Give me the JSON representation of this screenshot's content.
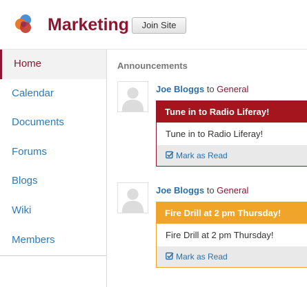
{
  "site": {
    "title": "Marketing",
    "join_label": "Join Site"
  },
  "colors": {
    "brand": "#8d1530",
    "link": "#2b7bb9",
    "announcement_red": "#a5151d",
    "announcement_orange": "#f0a42a"
  },
  "sidebar": {
    "items": [
      {
        "label": "Home",
        "active": true
      },
      {
        "label": "Calendar",
        "active": false
      },
      {
        "label": "Documents",
        "active": false
      },
      {
        "label": "Forums",
        "active": false
      },
      {
        "label": "Blogs",
        "active": false
      },
      {
        "label": "Wiki",
        "active": false
      },
      {
        "label": "Members",
        "active": false
      }
    ]
  },
  "announcements": {
    "title": "Announcements",
    "entries": [
      {
        "author": "Joe Bloggs",
        "connector": "to",
        "group": "General",
        "headline": "Tune in to Radio Liferay!",
        "body": "Tune in to Radio Liferay!",
        "action": "Mark as Read",
        "style": "red"
      },
      {
        "author": "Joe Bloggs",
        "connector": "to",
        "group": "General",
        "headline": "Fire Drill at 2 pm Thursday!",
        "body": "Fire Drill at 2 pm Thursday!",
        "action": "Mark as Read",
        "style": "orange"
      }
    ]
  }
}
